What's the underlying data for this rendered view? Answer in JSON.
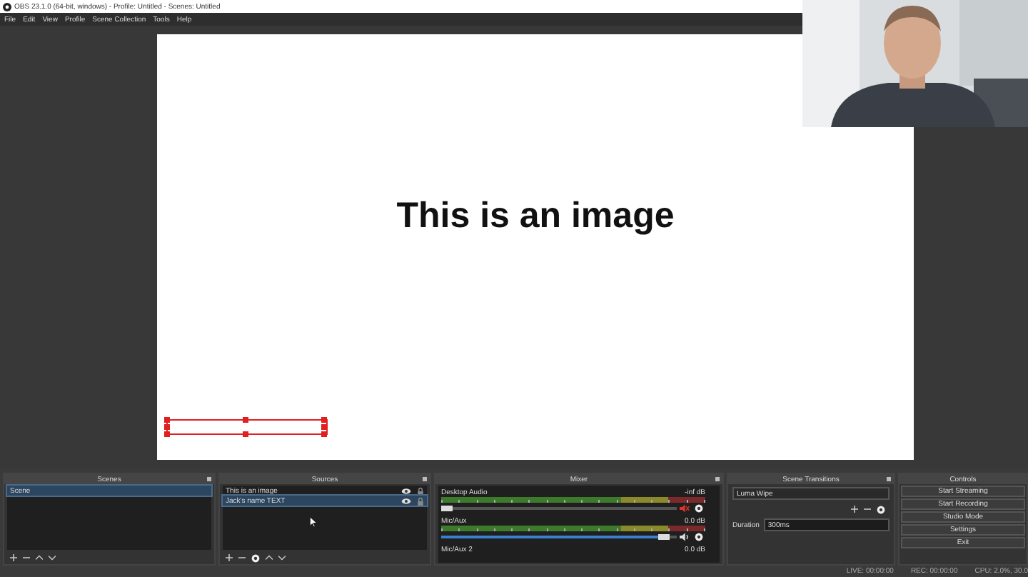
{
  "window": {
    "title": "OBS 23.1.0 (64-bit, windows) - Profile: Untitled - Scenes: Untitled"
  },
  "menu": [
    "File",
    "Edit",
    "View",
    "Profile",
    "Scene Collection",
    "Tools",
    "Help"
  ],
  "canvas": {
    "text": "This is an image",
    "selection": true
  },
  "scenes": {
    "title": "Scenes",
    "items": [
      {
        "label": "Scene",
        "selected": true
      }
    ]
  },
  "sources": {
    "title": "Sources",
    "items": [
      {
        "label": "This is an image",
        "selected": false
      },
      {
        "label": "Jack's name TEXT",
        "selected": true
      }
    ]
  },
  "mixer": {
    "title": "Mixer",
    "channels": [
      {
        "name": "Desktop Audio",
        "reading": "-inf dB",
        "muted": true,
        "level": 0.0
      },
      {
        "name": "Mic/Aux",
        "reading": "0.0 dB",
        "muted": false,
        "level": 0.97
      },
      {
        "name": "Mic/Aux 2",
        "reading": "0.0 dB"
      }
    ]
  },
  "transitions": {
    "title": "Scene Transitions",
    "transition": "Luma Wipe",
    "duration_label": "Duration",
    "duration": "300ms"
  },
  "controls": {
    "title": "Controls",
    "buttons": [
      "Start Streaming",
      "Start Recording",
      "Studio Mode",
      "Settings",
      "Exit"
    ]
  },
  "status_bar": [
    "LIVE: 00:00:00",
    "REC: 00:00:00",
    "CPU: 2.0%, 30.0"
  ]
}
